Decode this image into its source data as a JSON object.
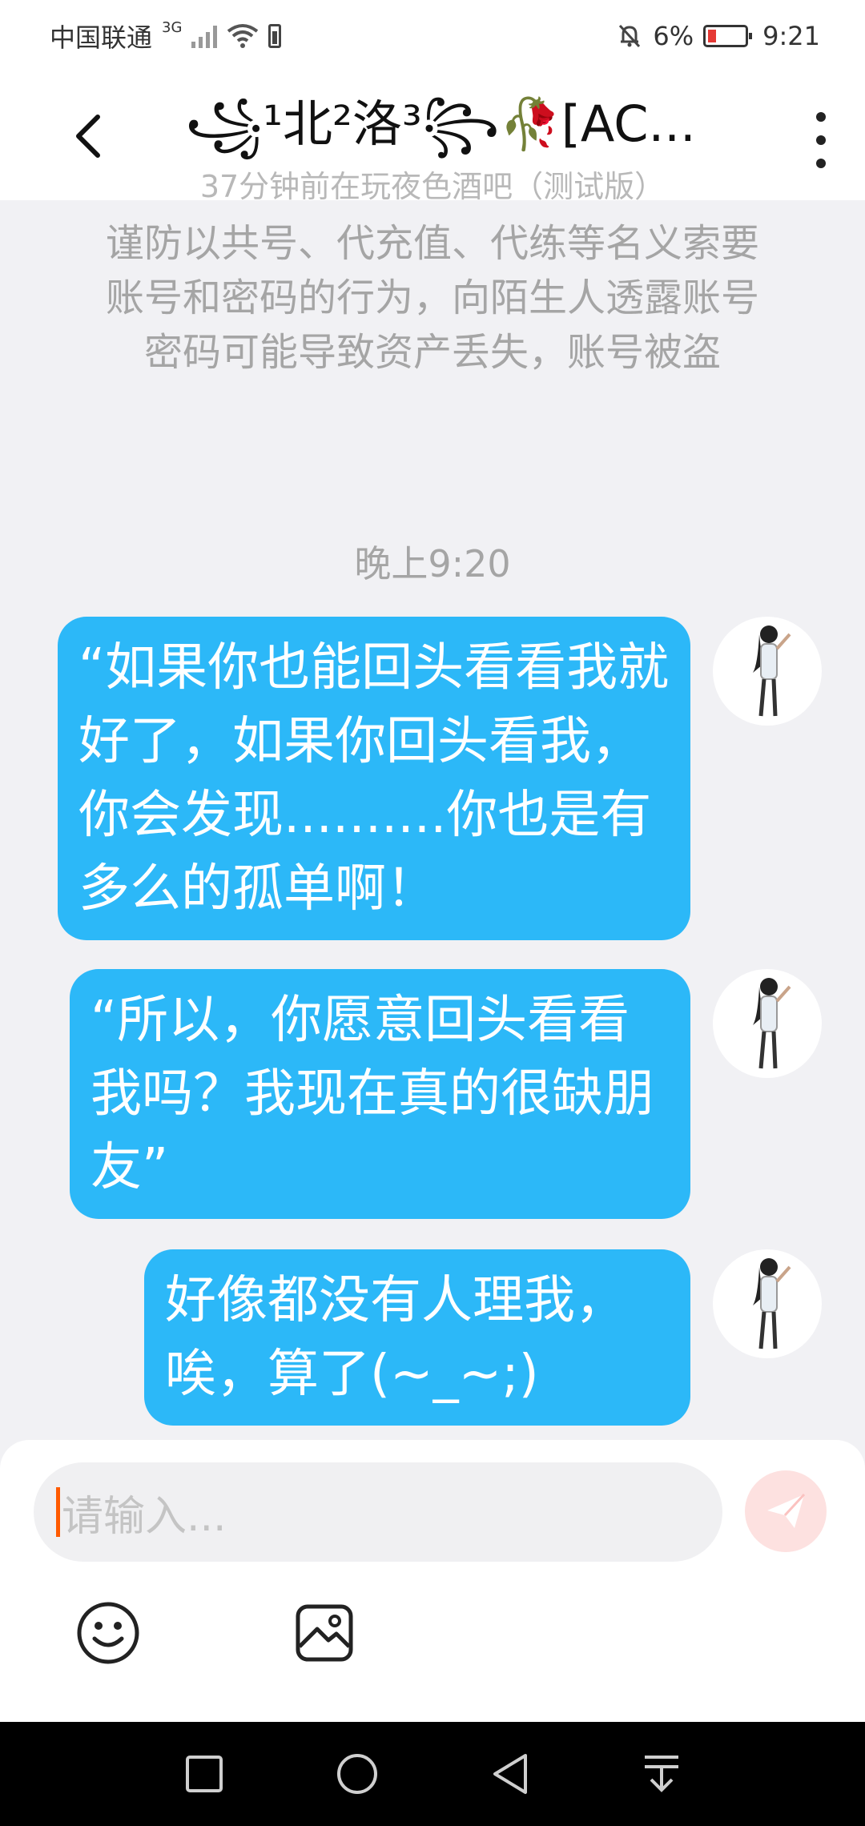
{
  "status_bar": {
    "carrier": "中国联通",
    "network": "3G",
    "battery_percent": "6%",
    "time": "9:21"
  },
  "header": {
    "title": "꧁¹北²洛³꧂🥀[AC...",
    "subtitle": "37分钟前在玩夜色酒吧（测试版）"
  },
  "notice": "谨防以共号、代充值、代练等名义索要账号和密码的行为，向陌生人透露账号密码可能导致资产丢失，账号被盗",
  "time_divider": "晚上9:20",
  "messages": [
    {
      "text": "“如果你也能回头看看我就好了，如果你回头看我，你会发现..........你也是有多么的孤单啊！"
    },
    {
      "text": "“所以，你愿意回头看看我吗？我现在真的很缺朋友”"
    },
    {
      "text": "好像都没有人理我，唉，算了(~_~;)"
    }
  ],
  "input": {
    "placeholder": "请输入..."
  },
  "colors": {
    "bubble": "#2cb8f8",
    "send_button": "#fde1e0",
    "caret": "#ff5a00"
  }
}
